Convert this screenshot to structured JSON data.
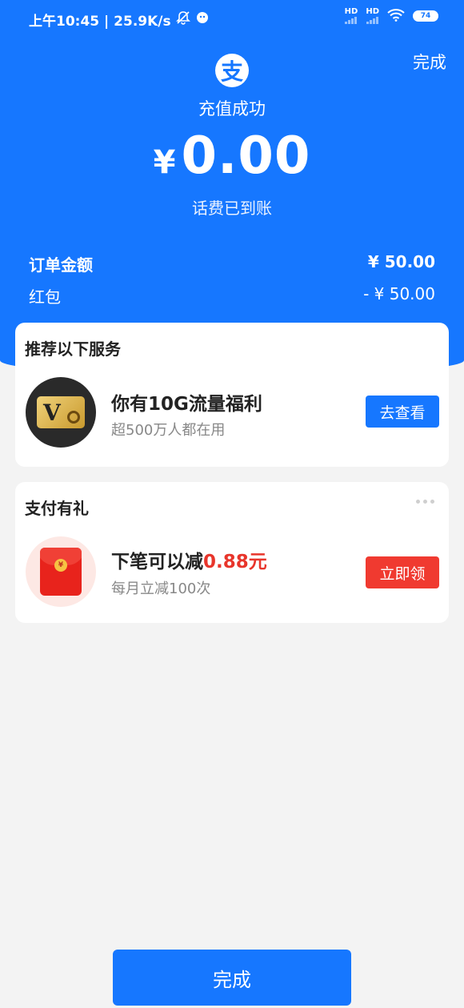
{
  "status_bar": {
    "time_speed": "上午10:45 | 25.9K/s",
    "sim1": "HD",
    "sim2": "HD",
    "battery": "74"
  },
  "header": {
    "logo_glyph": "支",
    "done_label": "完成",
    "title": "充值成功",
    "currency_symbol": "¥",
    "amount": "0.00",
    "subtitle": "话费已到账"
  },
  "summary": {
    "order_label": "订单金额",
    "order_value": "¥ 50.00",
    "redpacket_label": "红包",
    "redpacket_value": "- ¥ 50.00"
  },
  "recommend": {
    "title": "推荐以下服务",
    "item_title": "你有10G流量福利",
    "item_sub": "超500万人都在用",
    "button": "去查看",
    "icon_letter": "V"
  },
  "gift": {
    "title": "支付有礼",
    "item_title_prefix": "下笔可以减",
    "item_title_amount": "0.88元",
    "item_sub": "每月立减100次",
    "button": "立即领",
    "coin_glyph": "¥"
  },
  "footer": {
    "done_label": "完成"
  },
  "colors": {
    "brand_blue": "#1677ff",
    "accent_red": "#f03a30",
    "page_bg": "#f3f3f3"
  }
}
